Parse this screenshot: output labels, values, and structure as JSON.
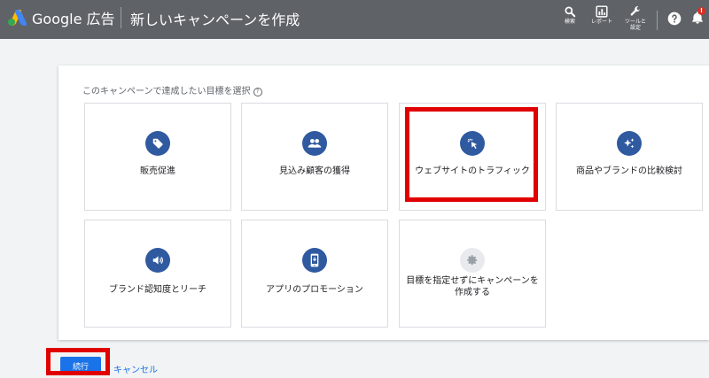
{
  "topbar": {
    "brand_name": "Google 広告",
    "page_title": "新しいキャンペーンを作成",
    "tools": {
      "search_label": "検索",
      "reports_label": "レポート",
      "tools_label": "ツールと\n設定"
    },
    "notification_badge": "!"
  },
  "campaign": {
    "prompt": "このキャンペーンで達成したい目標を選択",
    "help_glyph": "?",
    "goals": [
      {
        "label": "販売促進",
        "icon": "tag-icon"
      },
      {
        "label": "見込み顧客の獲得",
        "icon": "people-icon"
      },
      {
        "label": "ウェブサイトのトラフィック",
        "icon": "cursor-click-icon"
      },
      {
        "label": "商品やブランドの比較検討",
        "icon": "sparkle-icon"
      },
      {
        "label": "ブランド認知度とリーチ",
        "icon": "speaker-icon"
      },
      {
        "label": "アプリのプロモーション",
        "icon": "smartphone-icon"
      },
      {
        "label": "目標を指定せずにキャンペーンを\n作成する",
        "icon": "gear-icon"
      }
    ]
  },
  "actions": {
    "continue_label": "続行",
    "cancel_label": "キャンセル"
  },
  "colors": {
    "topbar": "#5f6368",
    "icon_circle": "#2f5aa0",
    "primary_button": "#1a73e8",
    "highlight": "#e00000"
  }
}
